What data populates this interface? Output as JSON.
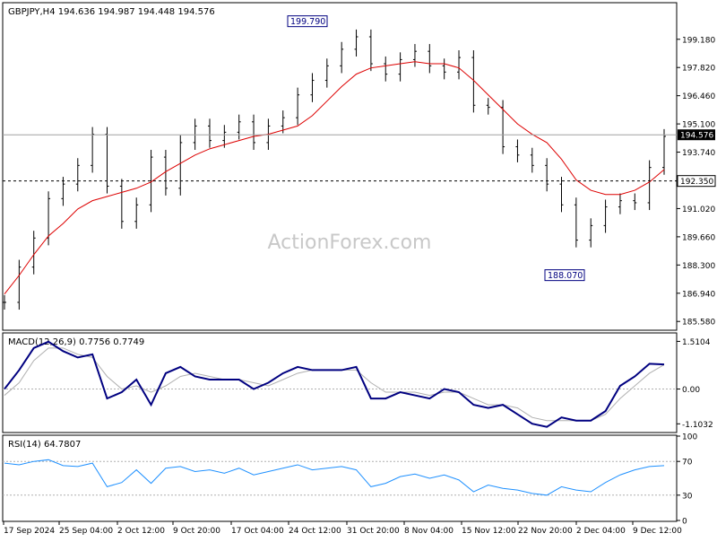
{
  "chart_data": [
    {
      "type": "candlestick",
      "title": "GBPJPY,H4  194.636 194.987 194.448 194.576",
      "symbol": "GBPJPY",
      "timeframe": "H4",
      "ohlc_readout": "194.636 194.987 194.448 194.576",
      "watermark": "ActionForex.com",
      "ylim": [
        185.2,
        200.9
      ],
      "yticks": [
        "199.180",
        "197.820",
        "196.460",
        "195.100",
        "193.740",
        "192.380",
        "191.020",
        "189.660",
        "188.300",
        "186.940",
        "185.580"
      ],
      "last_price_label": "194.576",
      "level_line_label": "192.350",
      "annotations": [
        {
          "label": "199.790",
          "value": 199.79
        },
        {
          "label": "188.070",
          "value": 188.07
        }
      ],
      "series": [
        {
          "type": "line",
          "color": "#dd0000",
          "values": [
            186.9,
            187.8,
            188.8,
            189.7,
            190.3,
            191.0,
            191.4,
            191.6,
            191.8,
            192.0,
            192.3,
            192.8,
            193.2,
            193.6,
            193.9,
            194.1,
            194.3,
            194.5,
            194.6,
            194.8,
            195.0,
            195.5,
            196.2,
            196.9,
            197.5,
            197.8,
            197.9,
            198.0,
            198.1,
            198.0,
            198.0,
            197.8,
            197.2,
            196.5,
            195.8,
            195.1,
            194.6,
            194.2,
            193.4,
            192.4,
            191.9,
            191.7,
            191.7,
            191.9,
            192.3,
            192.9
          ]
        }
      ],
      "close_values": [
        186.5,
        188.2,
        189.6,
        191.5,
        192.2,
        193.1,
        194.6,
        192.1,
        190.4,
        191.2,
        193.5,
        192.0,
        194.2,
        195.0,
        194.3,
        194.7,
        195.2,
        194.2,
        195.0,
        195.4,
        196.5,
        197.2,
        197.9,
        198.7,
        199.3,
        198.0,
        197.5,
        198.2,
        198.6,
        197.9,
        197.6,
        198.3,
        196.0,
        195.9,
        194.0,
        193.6,
        193.1,
        192.2,
        191.2,
        189.5,
        190.2,
        191.1,
        191.4,
        191.3,
        193.0,
        194.5
      ]
    },
    {
      "type": "line",
      "title": "MACD(12,26,9) 0.7756 0.7749",
      "yticks": [
        "1.5104",
        "0.00",
        "-1.1032"
      ],
      "ylim": [
        -1.35,
        1.75
      ],
      "series": [
        {
          "type": "line",
          "color": "#000080",
          "values": [
            0.0,
            0.6,
            1.3,
            1.5,
            1.2,
            1.0,
            1.1,
            -0.3,
            -0.1,
            0.3,
            -0.5,
            0.5,
            0.7,
            0.4,
            0.3,
            0.3,
            0.3,
            0.0,
            0.2,
            0.5,
            0.7,
            0.6,
            0.6,
            0.6,
            0.7,
            -0.3,
            -0.3,
            -0.1,
            -0.2,
            -0.3,
            0.0,
            -0.1,
            -0.5,
            -0.6,
            -0.5,
            -0.8,
            -1.1,
            -1.2,
            -0.9,
            -1.0,
            -1.0,
            -0.7,
            0.1,
            0.4,
            0.8,
            0.78
          ]
        },
        {
          "type": "line",
          "color": "#b0b0b0",
          "values": [
            -0.2,
            0.2,
            0.9,
            1.3,
            1.3,
            1.1,
            1.0,
            0.4,
            0.0,
            0.1,
            -0.1,
            0.1,
            0.4,
            0.5,
            0.4,
            0.3,
            0.3,
            0.2,
            0.1,
            0.3,
            0.5,
            0.6,
            0.6,
            0.6,
            0.6,
            0.2,
            -0.1,
            -0.1,
            -0.1,
            -0.2,
            -0.1,
            -0.1,
            -0.3,
            -0.5,
            -0.5,
            -0.6,
            -0.9,
            -1.0,
            -1.0,
            -1.0,
            -1.0,
            -0.8,
            -0.3,
            0.1,
            0.5,
            0.77
          ]
        }
      ]
    },
    {
      "type": "line",
      "title": "RSI(14) 64.7807",
      "ylim": [
        0,
        100
      ],
      "yticks": [
        "100",
        "70",
        "30",
        "0"
      ],
      "levels": [
        70,
        30
      ],
      "series": [
        {
          "type": "line",
          "color": "#1e90ff",
          "values": [
            68,
            66,
            70,
            72,
            65,
            64,
            68,
            40,
            45,
            60,
            44,
            62,
            64,
            58,
            60,
            56,
            62,
            54,
            58,
            62,
            66,
            60,
            62,
            64,
            60,
            40,
            44,
            52,
            55,
            50,
            54,
            48,
            34,
            42,
            38,
            36,
            32,
            30,
            40,
            36,
            34,
            45,
            54,
            60,
            64,
            65
          ]
        }
      ]
    }
  ],
  "x_labels": [
    "17 Sep 2024",
    "25 Sep 04:00",
    "2 Oct 12:00",
    "9 Oct 20:00",
    "17 Oct 04:00",
    "24 Oct 12:00",
    "31 Oct 20:00",
    "8 Nov 04:00",
    "15 Nov 12:00",
    "22 Nov 20:00",
    "2 Dec 04:00",
    "9 Dec 12:00"
  ]
}
